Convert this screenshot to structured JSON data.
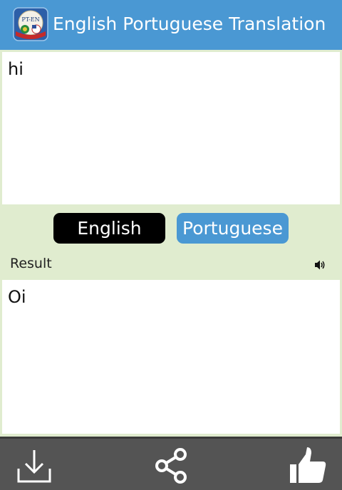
{
  "app": {
    "title": "English Portuguese Translation",
    "logo_text": "PT-EN",
    "accent_color": "#4a98d3"
  },
  "input": {
    "value": "hi"
  },
  "languages": {
    "source_label": "English",
    "target_label": "Portuguese"
  },
  "result": {
    "label": "Result",
    "text": "Oi",
    "speaker_icon": "speaker-icon"
  },
  "bottom_bar": {
    "icons": [
      "download-icon",
      "share-icon",
      "thumbs-up-icon"
    ]
  }
}
